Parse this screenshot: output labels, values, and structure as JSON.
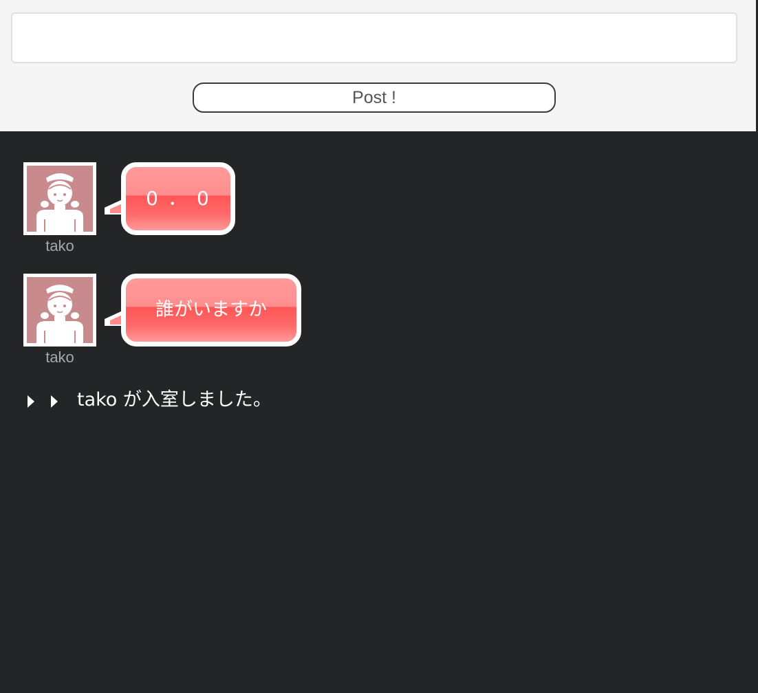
{
  "post_form": {
    "input_value": "",
    "input_placeholder": "",
    "post_button_label": "Post !"
  },
  "log": {
    "messages": [
      {
        "user": "tako",
        "avatar_icon": "maid-avatar-icon",
        "text": "0．0"
      },
      {
        "user": "tako",
        "avatar_icon": "maid-avatar-icon",
        "text": "誰がいますか"
      }
    ],
    "notice": {
      "text": "tako が入室しました。",
      "icon": "double-triangle-arrow-icon"
    }
  },
  "colors": {
    "form_background": "#f5f5f5",
    "log_background": "#242527",
    "bubble_red": "#ff5656",
    "avatar_pink": "#c98a8e",
    "username_gray": "#a8a8a8"
  }
}
